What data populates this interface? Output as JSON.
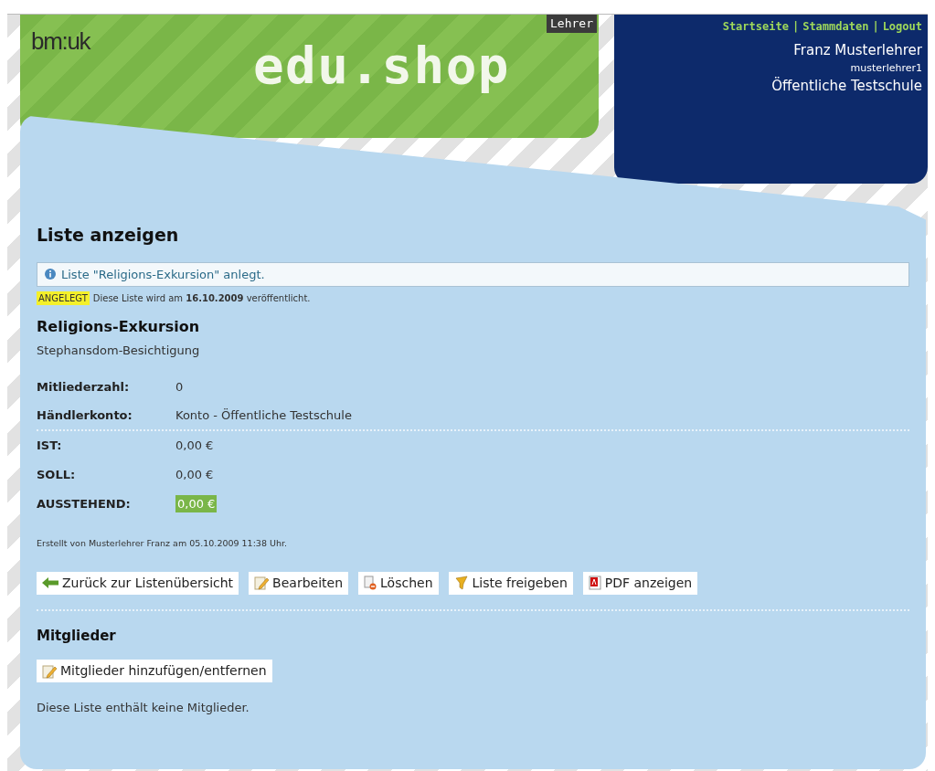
{
  "header": {
    "ministry_logo": "bm:uk",
    "shop_logo": "edu.shop",
    "role_badge": "Lehrer",
    "top_links": [
      "Startseite",
      "Stammdaten",
      "Logout"
    ],
    "link_separator": "|",
    "user_name": "Franz Musterlehrer",
    "username": "musterlehrer1",
    "school": "Öffentliche Testschule"
  },
  "page_title": "Liste anzeigen",
  "notice": "Liste \"Religions-Exkursion\" anlegt.",
  "status": {
    "badge": "ANGELEGT",
    "text": "Diese Liste wird am **16.10.2009** veröffentlicht."
  },
  "list": {
    "title": "Religions-Exkursion",
    "description": "Stephansdom-Besichtigung",
    "fields": [
      {
        "label": "Mitliederzahl:",
        "value": "0",
        "highlight": false,
        "divider_after": false
      },
      {
        "label": "Händlerkonto:",
        "value": "Konto - Öffentliche Testschule",
        "highlight": false,
        "divider_after": true
      },
      {
        "label": "IST:",
        "value": "0,00 €",
        "highlight": false,
        "divider_after": false
      },
      {
        "label": "SOLL:",
        "value": "0,00 €",
        "highlight": false,
        "divider_after": false
      },
      {
        "label": "AUSSTEHEND:",
        "value": "0,00 €",
        "highlight": true,
        "divider_after": false
      }
    ],
    "created": "Erstellt von Musterlehrer Franz am 05.10.2009 11:38 Uhr."
  },
  "actions": [
    {
      "label": "Zurück zur Listenübersicht",
      "kind": "back"
    },
    {
      "label": "Bearbeiten",
      "kind": "edit"
    },
    {
      "label": "Löschen",
      "kind": "delete"
    },
    {
      "label": "Liste freigeben",
      "kind": "release"
    },
    {
      "label": "PDF anzeigen",
      "kind": "pdf"
    }
  ],
  "members": {
    "title": "Mitglieder",
    "button": {
      "label": "Mitglieder hinzufügen/entfernen",
      "kind": "edit"
    },
    "empty_text": "Diese Liste enthält keine Mitglieder."
  }
}
